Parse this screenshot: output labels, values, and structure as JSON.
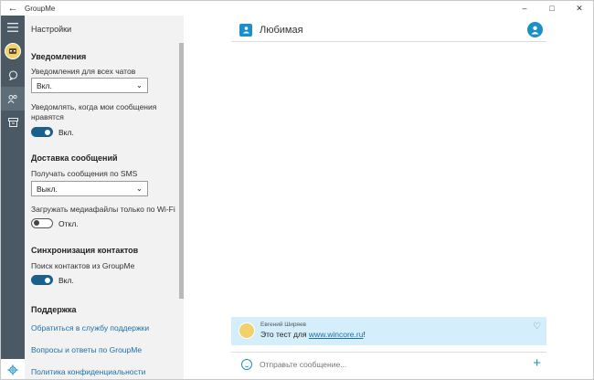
{
  "app": {
    "title": "GroupMe"
  },
  "settings": {
    "title": "Настройки",
    "notifications": {
      "heading": "Уведомления",
      "all_chats_label": "Уведомления для всех чатов",
      "all_chats_value": "Вкл.",
      "likes_label_line1": "Уведомлять, когда мои сообщения",
      "likes_label_line2": "нравятся",
      "likes_state": "Вкл."
    },
    "delivery": {
      "heading": "Доставка сообщений",
      "sms_label": "Получать сообщения по SMS",
      "sms_value": "Выкл.",
      "wifi_label": "Загружать медиафайлы только по Wi-Fi",
      "wifi_state": "Откл."
    },
    "sync": {
      "heading": "Синхронизация контактов",
      "search_label": "Поиск контактов из GroupMe",
      "search_state": "Вкл."
    },
    "support": {
      "heading": "Поддержка",
      "links": [
        "Обратиться в службу поддержки",
        "Вопросы и ответы по GroupMe",
        "Политика конфиденциальности"
      ]
    }
  },
  "chat": {
    "title": "Любимая",
    "message": {
      "author": "Евгений Ширяев",
      "text_prefix": "Это тест для ",
      "link": "www.wincore.ru",
      "text_suffix": "!"
    },
    "composer": {
      "placeholder": "Отправьте сообщение..."
    }
  },
  "icons": {
    "back": "back-arrow-icon",
    "menu": "hamburger-icon",
    "chats": "chat-bubble-icon",
    "contacts": "contacts-icon",
    "archive": "archive-icon",
    "settings": "gear-icon",
    "group": "group-icon",
    "emoji": "emoji-icon",
    "attach": "plus-icon",
    "like": "heart-icon"
  },
  "colors": {
    "accent": "#1b8fc9",
    "rail": "#4a5964",
    "message_bg": "#d5eefb",
    "toggle_on": "#1b5f8e"
  }
}
